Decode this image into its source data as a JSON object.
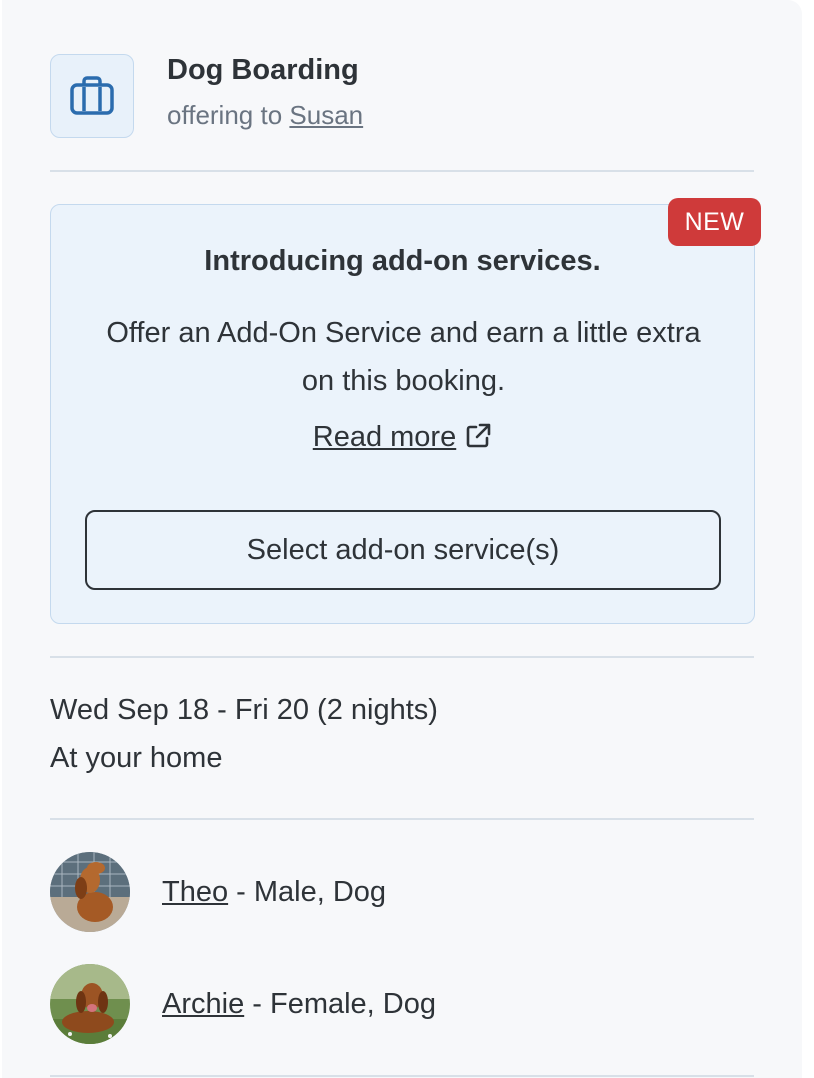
{
  "service": {
    "title": "Dog Boarding",
    "offering_prefix": "offering to",
    "client_name": "Susan",
    "icon": "briefcase-icon"
  },
  "promo": {
    "badge": "NEW",
    "title": "Introducing add-on services.",
    "body": "Offer an Add-On Service and earn a little extra on this booking.",
    "read_more": "Read more",
    "read_more_icon": "external-link-icon",
    "button_label": "Select add-on service(s)"
  },
  "booking": {
    "dates": "Wed Sep 18 - Fri 20 (2 nights)",
    "location": "At your home"
  },
  "pets": [
    {
      "name": "Theo",
      "details": " - Male, Dog"
    },
    {
      "name": "Archie",
      "details": " - Female, Dog"
    }
  ],
  "colors": {
    "accent_badge": "#cf3a3a",
    "promo_background": "#ebf3fb",
    "text": "#2e3338"
  }
}
